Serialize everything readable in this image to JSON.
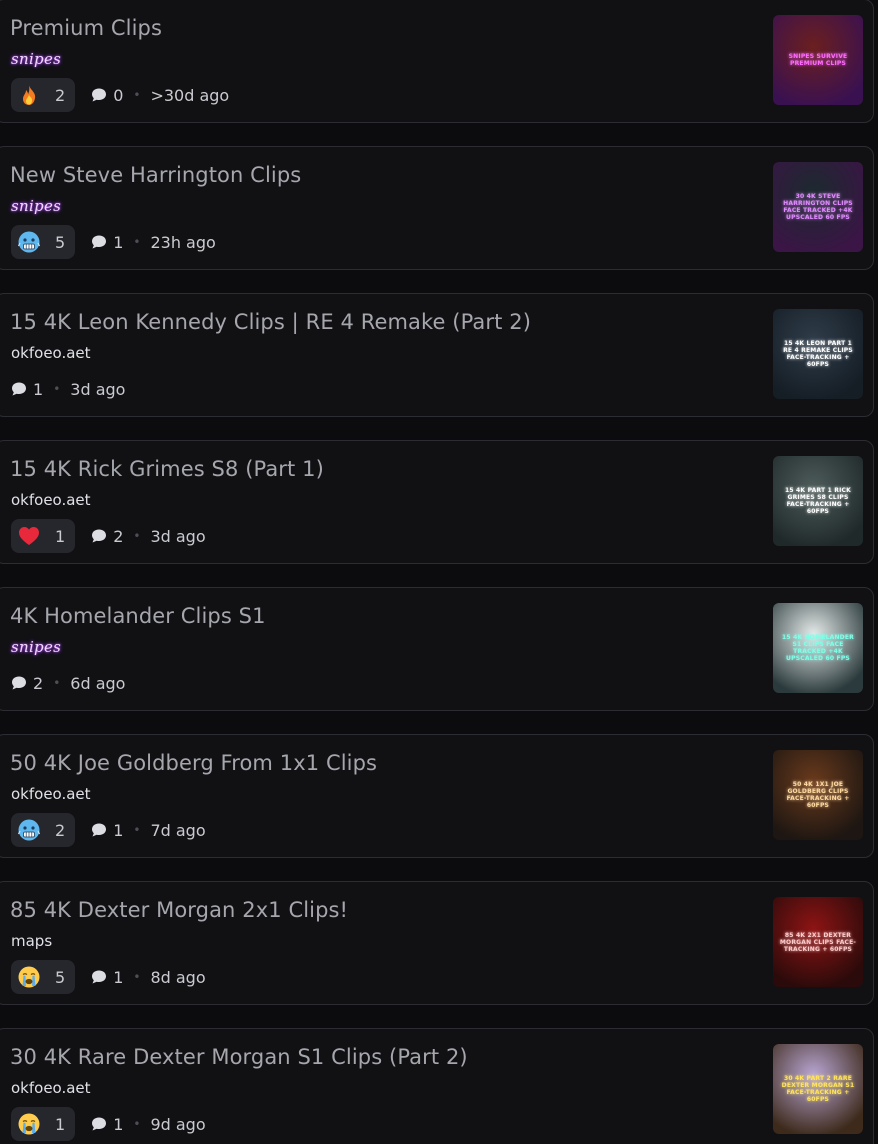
{
  "feed": {
    "posts": [
      {
        "title": "Premium Clips",
        "author": "snipes",
        "author_style": "fancy",
        "reaction": {
          "emoji": "fire",
          "count": "2"
        },
        "comments": "0",
        "time": ">30d ago",
        "thumbnail": {
          "caption": "SNIPES SURVIVE PREMIUM CLIPS",
          "bg_from": "#6b1f1f",
          "bg_to": "#3a1150",
          "text_color": "#ff6bff"
        }
      },
      {
        "title": "New Steve Harrington Clips",
        "author": "snipes",
        "author_style": "fancy",
        "reaction": {
          "emoji": "cold-face",
          "count": "5"
        },
        "comments": "1",
        "time": "23h ago",
        "thumbnail": {
          "caption": "30 4K STEVE HARRINGTON CLIPS FACE TRACKED +4K UPSCALED 60 FPS",
          "bg_from": "#1b2a2e",
          "bg_to": "#3a1545",
          "text_color": "#e08bff"
        }
      },
      {
        "title": "15 4K Leon Kennedy Clips | RE 4 Remake (Part 2)",
        "author": "okfoeo.aet",
        "author_style": "plain",
        "reaction": null,
        "comments": "1",
        "time": "3d ago",
        "thumbnail": {
          "caption": "15 4K LEON PART 1 RE 4 REMAKE CLIPS FACE-TRACKING + 60FPS",
          "bg_from": "#2f3d4a",
          "bg_to": "#151d25",
          "text_color": "#ffffff"
        }
      },
      {
        "title": "15 4K Rick Grimes S8 (Part 1)",
        "author": "okfoeo.aet",
        "author_style": "plain",
        "reaction": {
          "emoji": "red-heart",
          "count": "1"
        },
        "comments": "2",
        "time": "3d ago",
        "thumbnail": {
          "caption": "15 4K PART 1 RICK GRIMES S8 CLIPS FACE-TRACKING + 60FPS",
          "bg_from": "#4d5c5a",
          "bg_to": "#20292a",
          "text_color": "#ffffff"
        }
      },
      {
        "title": "4K Homelander Clips S1",
        "author": "snipes",
        "author_style": "fancy",
        "reaction": null,
        "comments": "2",
        "time": "6d ago",
        "thumbnail": {
          "caption": "15 4K HOMELANDER S1 CLIPS FACE TRACKED +4K UPSCALED 60 FPS",
          "bg_from": "#e6ebea",
          "bg_to": "#2b3a3c",
          "text_color": "#7dffe8"
        }
      },
      {
        "title": "50 4K Joe Goldberg From 1x1 Clips",
        "author": "okfoeo.aet",
        "author_style": "plain",
        "reaction": {
          "emoji": "cold-face",
          "count": "2"
        },
        "comments": "1",
        "time": "7d ago",
        "thumbnail": {
          "caption": "50 4K 1X1 JOE GOLDBERG CLIPS FACE-TRACKING + 60FPS",
          "bg_from": "#6a3a1c",
          "bg_to": "#1d1612",
          "text_color": "#ffd9a0"
        }
      },
      {
        "title": "85 4K Dexter Morgan 2x1 Clips!",
        "author": "maps",
        "author_style": "plain",
        "reaction": {
          "emoji": "crying-face",
          "count": "5"
        },
        "comments": "1",
        "time": "8d ago",
        "thumbnail": {
          "caption": "85 4K 2X1 DEXTER MORGAN CLIPS FACE-TRACKING + 60FPS",
          "bg_from": "#8e1414",
          "bg_to": "#2a0a0a",
          "text_color": "#ffcccc"
        }
      },
      {
        "title": "30 4K Rare Dexter Morgan S1 Clips (Part 2)",
        "author": "okfoeo.aet",
        "author_style": "plain",
        "reaction": {
          "emoji": "crying-face",
          "count": "1"
        },
        "comments": "1",
        "time": "9d ago",
        "thumbnail": {
          "caption": "30 4K PART 2 RARE DEXTER MORGAN S1 FACE-TRACKING + 60FPS",
          "bg_from": "#b9a6d4",
          "bg_to": "#3d2a1b",
          "text_color": "#ffe45c"
        }
      }
    ]
  }
}
